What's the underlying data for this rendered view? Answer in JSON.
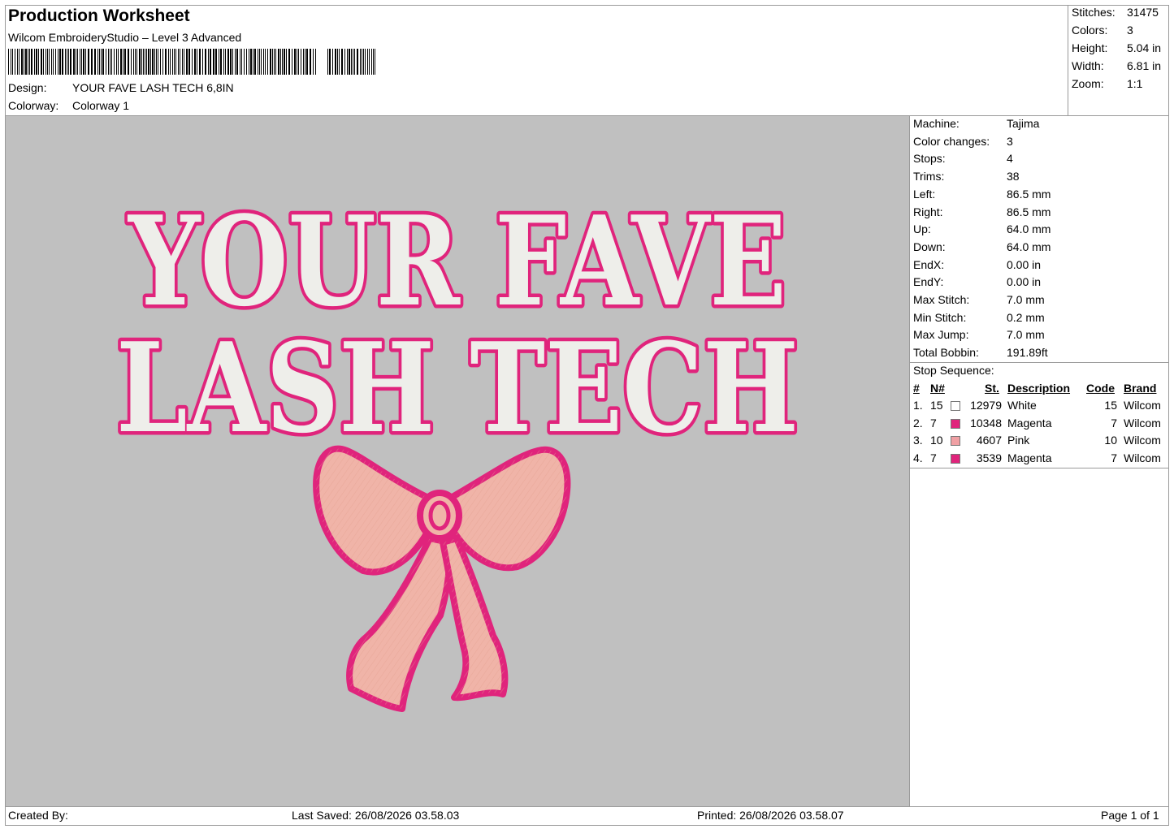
{
  "header": {
    "title": "Production Worksheet",
    "software": "Wilcom EmbroideryStudio – Level 3 Advanced",
    "design_label": "Design:",
    "design_value": "YOUR FAVE LASH TECH 6,8IN",
    "colorway_label": "Colorway:",
    "colorway_value": "Colorway 1"
  },
  "summary": [
    {
      "label": "Stitches:",
      "value": "31475"
    },
    {
      "label": "Colors:",
      "value": "3"
    },
    {
      "label": "Height:",
      "value": "5.04 in"
    },
    {
      "label": "Width:",
      "value": "6.81 in"
    },
    {
      "label": "Zoom:",
      "value": "1:1"
    }
  ],
  "machine_info": [
    {
      "label": "Machine:",
      "value": "Tajima"
    },
    {
      "label": "Color changes:",
      "value": "3"
    },
    {
      "label": "Stops:",
      "value": "4"
    },
    {
      "label": "Trims:",
      "value": "38"
    },
    {
      "label": "Left:",
      "value": "86.5 mm"
    },
    {
      "label": "Right:",
      "value": "86.5 mm"
    },
    {
      "label": "Up:",
      "value": "64.0 mm"
    },
    {
      "label": "Down:",
      "value": "64.0 mm"
    },
    {
      "label": "EndX:",
      "value": "0.00 in"
    },
    {
      "label": "EndY:",
      "value": "0.00 in"
    },
    {
      "label": "Max Stitch:",
      "value": "7.0 mm"
    },
    {
      "label": "Min Stitch:",
      "value": "0.2 mm"
    },
    {
      "label": "Max Jump:",
      "value": "7.0 mm"
    },
    {
      "label": "Total Bobbin:",
      "value": "191.89ft"
    }
  ],
  "stop_sequence": {
    "title": "Stop Sequence:",
    "columns": [
      "#",
      "N#",
      "St.",
      "Description",
      "Code",
      "Brand"
    ],
    "rows": [
      {
        "num": "1.",
        "n": "15",
        "color": "#ffffff",
        "st": "12979",
        "desc": "White",
        "code": "15",
        "brand": "Wilcom"
      },
      {
        "num": "2.",
        "n": "7",
        "color": "#e0247c",
        "st": "10348",
        "desc": "Magenta",
        "code": "7",
        "brand": "Wilcom"
      },
      {
        "num": "3.",
        "n": "10",
        "color": "#f0a0a4",
        "st": "4607",
        "desc": "Pink",
        "code": "10",
        "brand": "Wilcom"
      },
      {
        "num": "4.",
        "n": "7",
        "color": "#e0247c",
        "st": "3539",
        "desc": "Magenta",
        "code": "7",
        "brand": "Wilcom"
      }
    ]
  },
  "design_text": {
    "line1": "YOUR FAVE",
    "line2": "LASH TECH"
  },
  "colors": {
    "canvas": "#c0c0c0",
    "magenta": "#e0247c",
    "fill_white": "#eeeeea",
    "bow_fill": "#f0b4a8"
  },
  "footer": {
    "created_by": "Created By:",
    "last_saved": "Last Saved: 26/08/2026 03.58.03",
    "printed": "Printed: 26/08/2026 03.58.07",
    "page": "Page 1 of 1"
  }
}
